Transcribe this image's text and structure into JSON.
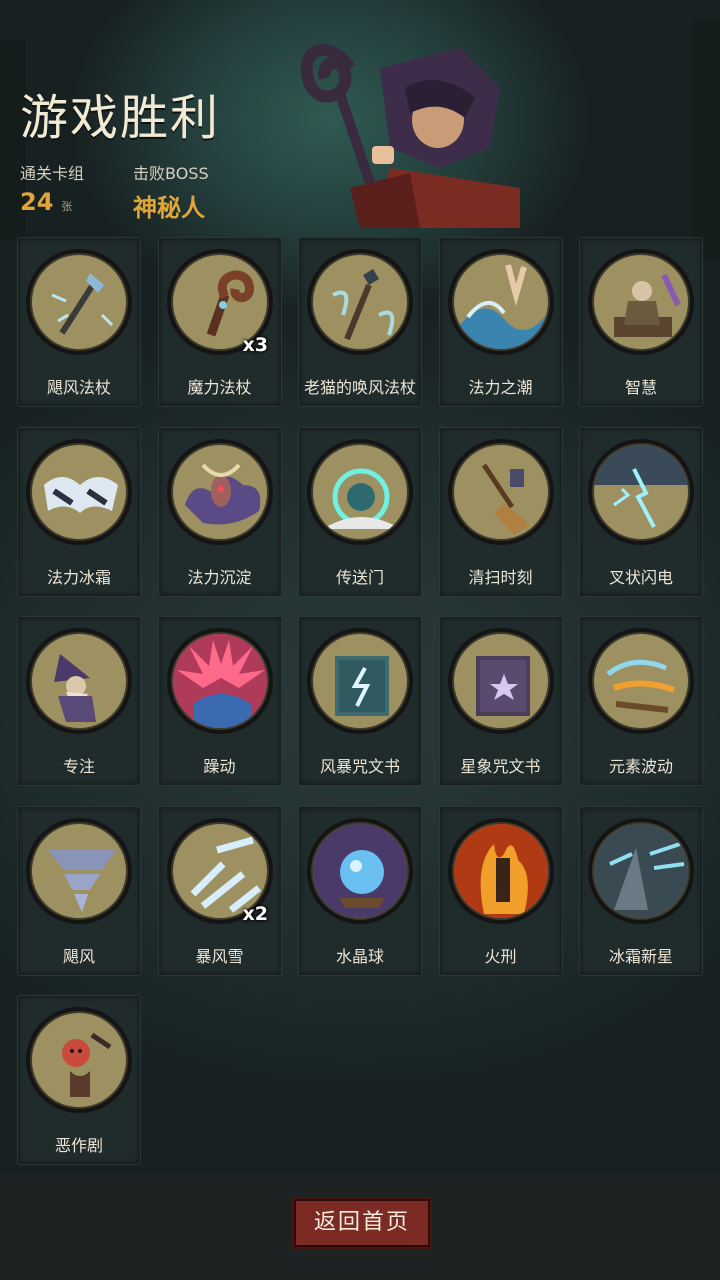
{
  "header": {
    "title": "游戏胜利",
    "deck_label": "通关卡组",
    "deck_count": "24",
    "deck_unit": "张",
    "boss_label": "击败BOSS",
    "boss_name": "神秘人"
  },
  "cards": [
    {
      "name": "飓风法杖",
      "icon": "staff-icon"
    },
    {
      "name": "魔力法杖",
      "icon": "spiral-staff-icon",
      "count": "x3"
    },
    {
      "name": "老猫的唤风法杖",
      "icon": "cat-staff-icon"
    },
    {
      "name": "法力之潮",
      "icon": "wave-icon"
    },
    {
      "name": "智慧",
      "icon": "sage-icon"
    },
    {
      "name": "法力冰霜",
      "icon": "frost-icon"
    },
    {
      "name": "法力沉淀",
      "icon": "eye-icon"
    },
    {
      "name": "传送门",
      "icon": "portal-icon"
    },
    {
      "name": "清扫时刻",
      "icon": "broom-icon"
    },
    {
      "name": "叉状闪电",
      "icon": "lightning-icon"
    },
    {
      "name": "专注",
      "icon": "wizard-icon"
    },
    {
      "name": "躁动",
      "icon": "burst-icon"
    },
    {
      "name": "风暴咒文书",
      "icon": "storm-book-icon"
    },
    {
      "name": "星象咒文书",
      "icon": "star-book-icon"
    },
    {
      "name": "元素波动",
      "icon": "element-icon"
    },
    {
      "name": "飓风",
      "icon": "tornado-icon"
    },
    {
      "name": "暴风雪",
      "icon": "blizzard-icon",
      "count": "x2"
    },
    {
      "name": "水晶球",
      "icon": "crystal-ball-icon"
    },
    {
      "name": "火刑",
      "icon": "fire-icon"
    },
    {
      "name": "冰霜新星",
      "icon": "ice-nova-icon"
    },
    {
      "name": "恶作剧",
      "icon": "prank-icon"
    }
  ],
  "footer": {
    "back_label": "返回首页"
  },
  "colors": {
    "accent": "#e0a63a",
    "button": "#7c2a24",
    "medal": "#9d9162"
  }
}
